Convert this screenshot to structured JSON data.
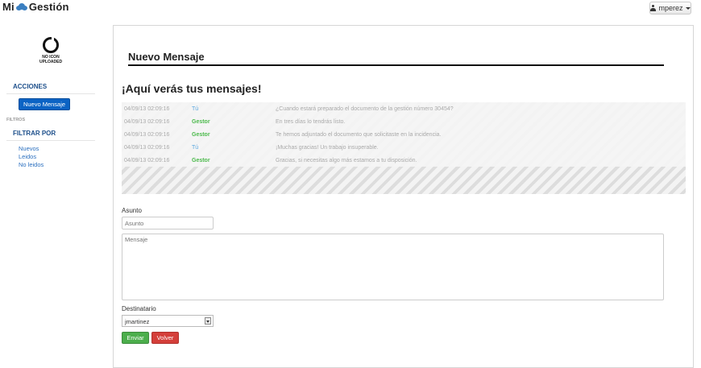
{
  "brand": {
    "prefix": "Mi",
    "suffix": "Gestión",
    "cloud_color": "#3a7fc1"
  },
  "user_menu": {
    "username": "mperez"
  },
  "sidebar": {
    "logo_text": [
      "NO ICON",
      "UPLOADED"
    ],
    "acciones_header": "ACCIONES",
    "nuevo_mensaje": "Nuevo Mensaje",
    "filtros_label": "FILTROS",
    "filtrar_header": "FILTRAR POR",
    "filters": [
      "Nuevos",
      "Leidos",
      "No leidos"
    ]
  },
  "panel": {
    "title": "Nuevo Mensaje",
    "headline": "¡Aquí verás tus mensajes!",
    "messages": [
      {
        "date": "04/09/13 02:09:16",
        "sender": "Tú",
        "sender_type": "tu",
        "text": "¿Cuando estará preparado el documento de la gestión número 30454?"
      },
      {
        "date": "04/09/13 02:09:16",
        "sender": "Gestor",
        "sender_type": "gestor",
        "text": "En tres días lo tendrás listo."
      },
      {
        "date": "04/09/13 02:09:16",
        "sender": "Gestor",
        "sender_type": "gestor",
        "text": "Te hemos adjuntado el documento que solicitaste en la incidencia."
      },
      {
        "date": "04/09/13 02:09:16",
        "sender": "Tú",
        "sender_type": "tu",
        "text": "¡Muchas gracias! Un trabajo insuperable."
      },
      {
        "date": "04/09/13 02:09:16",
        "sender": "Gestor",
        "sender_type": "gestor",
        "text": "Gracias, si necesitas algo más estamos a tu disposición."
      }
    ],
    "form": {
      "asunto_label": "Asunto",
      "asunto_placeholder": "Asunto",
      "mensaje_placeholder": "Mensaje",
      "destinatario_label": "Destinatario",
      "destinatario_value": "jmartinez",
      "enviar": "Enviar",
      "volver": "Volver"
    }
  }
}
